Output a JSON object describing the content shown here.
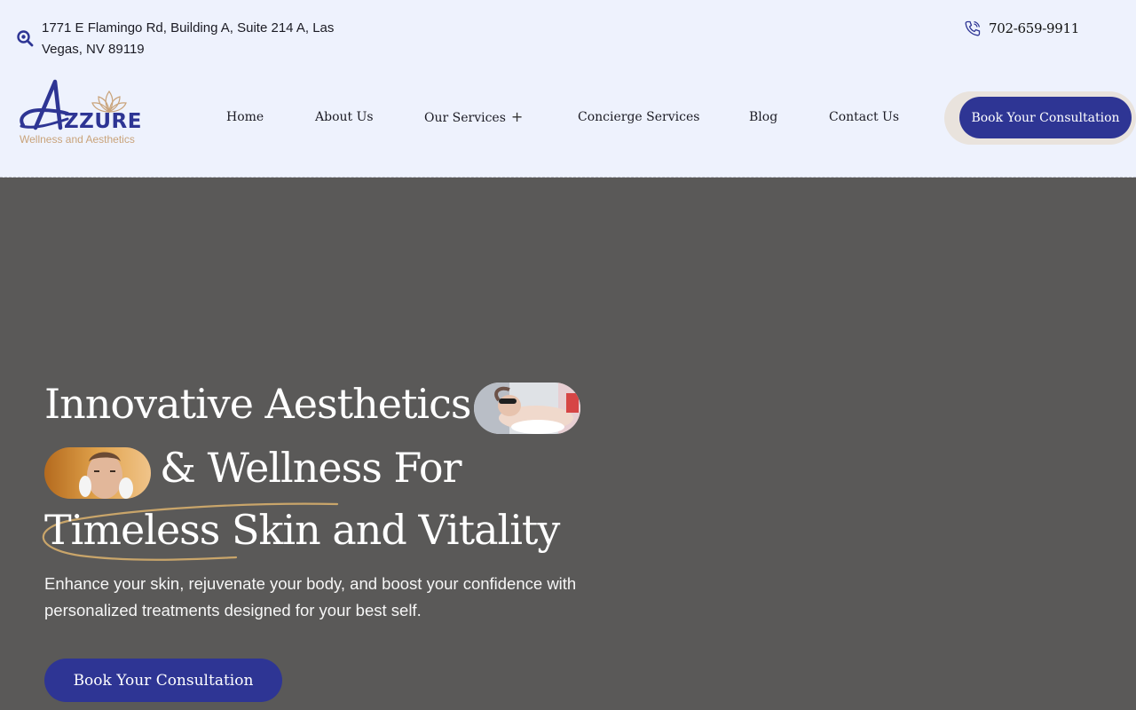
{
  "topbar": {
    "address": "1771 E Flamingo Rd, Building A, Suite 214 A, Las Vegas, NV 89119",
    "address_icon": "location-search-icon",
    "phone": "702-659-9911",
    "phone_icon": "phone-icon"
  },
  "logo": {
    "brand": "ZZURE",
    "tagline": "Wellness and Aesthetics",
    "brand_color": "#2e3594",
    "accent_color": "#c9a37a"
  },
  "nav": {
    "items": [
      {
        "label": "Home"
      },
      {
        "label": "About Us"
      },
      {
        "label": "Our Services",
        "has_submenu": true,
        "submenu_icon": "plus-icon"
      },
      {
        "label": "Concierge Services"
      },
      {
        "label": "Blog"
      },
      {
        "label": "Contact Us"
      }
    ],
    "cta": "Book Your Consultation"
  },
  "hero": {
    "line1": "Innovative Aesthetics",
    "line2": "& Wellness For",
    "line3": "Timeless Skin and Vitality",
    "subtitle": "Enhance your skin, rejuvenate your body, and boost your confidence with personalized treatments designed for your best self.",
    "cta": "Book Your Consultation",
    "image1": "laser-facial-treatment-photo",
    "image2": "man-facial-injection-photo"
  },
  "colors": {
    "header_bg": "#eef2fd",
    "hero_bg": "#5a5958",
    "primary": "#2e3594",
    "gold": "#c9a37a"
  }
}
